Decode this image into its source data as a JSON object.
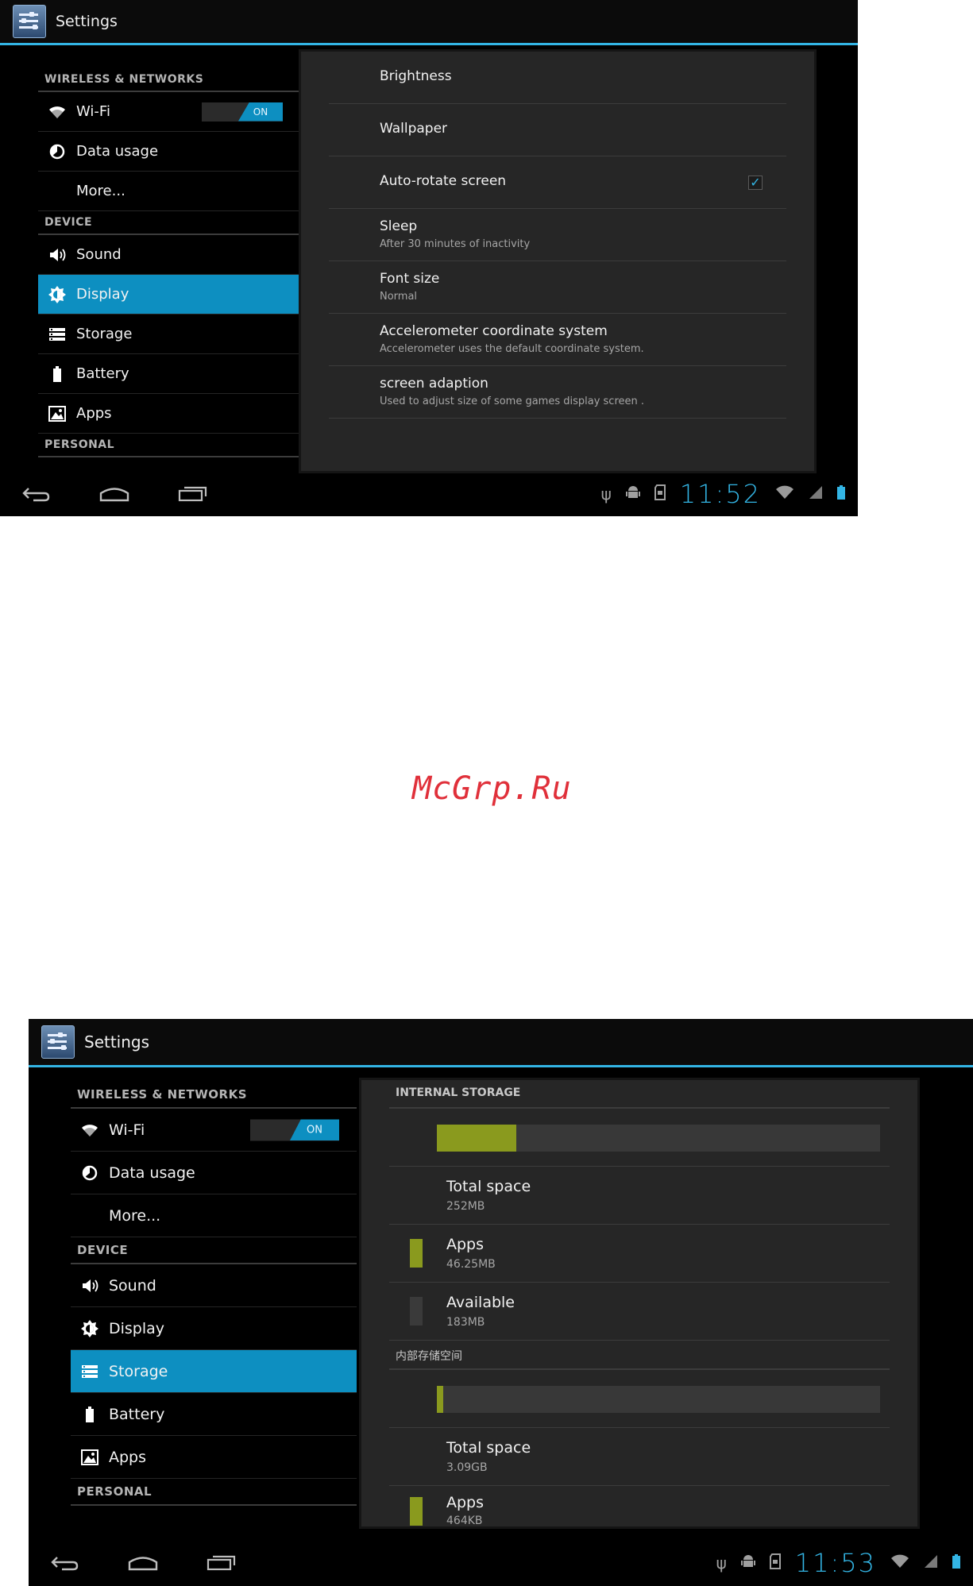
{
  "watermark": "McGrp.Ru",
  "shot1": {
    "title": "Settings",
    "sidebar": {
      "wireless_header": "WIRELESS & NETWORKS",
      "wifi": "Wi-Fi",
      "wifi_toggle": "ON",
      "data_usage": "Data usage",
      "more": "More...",
      "device_header": "DEVICE",
      "sound": "Sound",
      "display": "Display",
      "storage": "Storage",
      "battery": "Battery",
      "apps": "Apps",
      "personal_header": "PERSONAL"
    },
    "display_settings": {
      "brightness": "Brightness",
      "wallpaper": "Wallpaper",
      "auto_rotate": "Auto-rotate screen",
      "auto_rotate_checked": true,
      "sleep": "Sleep",
      "sleep_sub": "After 30 minutes of inactivity",
      "font_size": "Font size",
      "font_size_sub": "Normal",
      "accel": "Accelerometer coordinate system",
      "accel_sub": "Accelerometer uses the default coordinate system.",
      "adaption": "screen adaption",
      "adaption_sub": "Used to adjust size of some games display screen ."
    },
    "clock": "11:52"
  },
  "shot2": {
    "title": "Settings",
    "sidebar": {
      "wireless_header": "WIRELESS & NETWORKS",
      "wifi": "Wi-Fi",
      "wifi_toggle": "ON",
      "data_usage": "Data usage",
      "more": "More...",
      "device_header": "DEVICE",
      "sound": "Sound",
      "display": "Display",
      "storage": "Storage",
      "battery": "Battery",
      "apps": "Apps",
      "personal_header": "PERSONAL"
    },
    "storage": {
      "internal_header": "INTERNAL STORAGE",
      "internal_used_fraction": 0.18,
      "internal_total_label": "Total space",
      "internal_total": "252MB",
      "internal_apps_label": "Apps",
      "internal_apps": "46.25MB",
      "internal_avail_label": "Available",
      "internal_avail": "183MB",
      "second_header": "内部存储空间",
      "second_used_fraction": 0.015,
      "second_total_label": "Total space",
      "second_total": "3.09GB",
      "second_apps_label": "Apps",
      "second_apps": "464KB"
    },
    "clock": "11:53"
  },
  "colors": {
    "accent": "#33b5e5",
    "selected": "#0d8fc1",
    "apps_bar": "#8a9a1e"
  }
}
